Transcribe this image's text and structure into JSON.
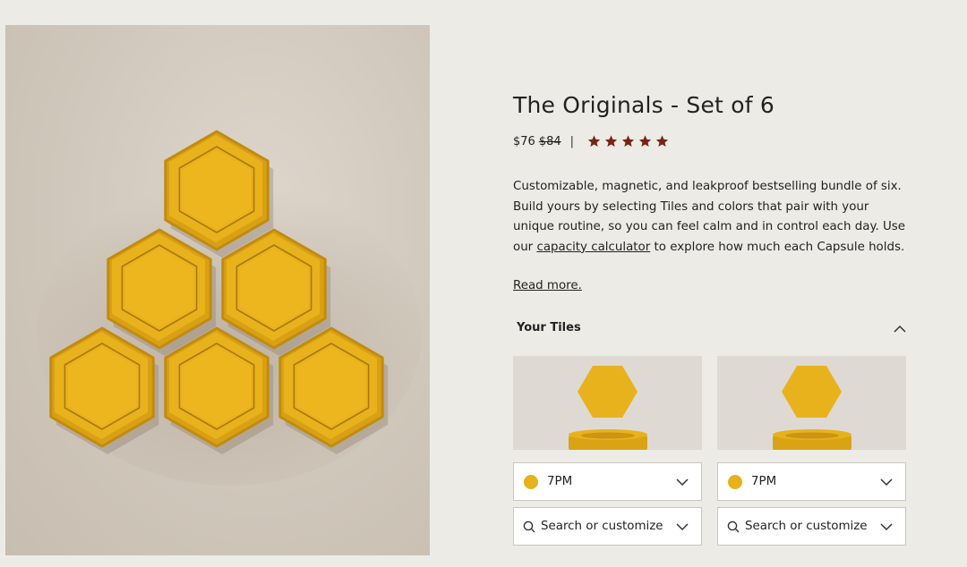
{
  "product": {
    "title": "The Originals - Set of 6",
    "price_current": "$76",
    "price_original": "$84",
    "separator": "|",
    "rating_stars": 5,
    "star_color": "#7a2414",
    "description_part1": "Customizable, magnetic, and leakproof bestselling bundle of six. Build yours by selecting Tiles and colors that pair with your unique routine, so you can feel calm and in control each day. Use our ",
    "description_link": "capacity calculator",
    "description_part2": " to explore how much each Capsule holds.",
    "read_more": "Read more."
  },
  "tiles": {
    "section_title": "Your Tiles",
    "tile_color": "#e8b21c",
    "slots": [
      {
        "time_label": "7PM",
        "search_placeholder": "Search or customize"
      },
      {
        "time_label": "7PM",
        "search_placeholder": "Search or customize"
      }
    ]
  },
  "icons": {
    "star": "star-icon",
    "chevron_up": "chevron-up-icon",
    "chevron_down": "chevron-down-icon",
    "search": "search-icon"
  }
}
